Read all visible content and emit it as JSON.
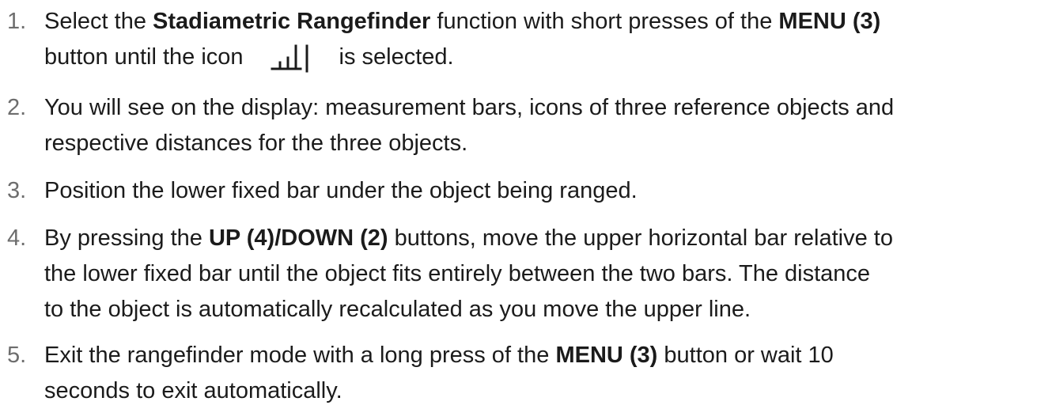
{
  "steps": [
    {
      "number": "1.",
      "line1": {
        "t1": "Select the ",
        "b1": "Stadiametric Rangefinder",
        "t2": " function with short presses of the ",
        "b2": "MENU (3)"
      },
      "line2": {
        "t1": "button until the icon",
        "icon": "stadiametric-rangefinder-icon",
        "t2": "is selected."
      }
    },
    {
      "number": "2.",
      "line1": "You will see on the display: measurement bars, icons of three reference objects and",
      "line2": "respective distances for the three objects."
    },
    {
      "number": "3.",
      "line1": "Position the lower fixed bar under the object being ranged."
    },
    {
      "number": "4.",
      "line1": {
        "t1": "By pressing the ",
        "b1": "UP (4)/DOWN (2)",
        "t2": " buttons, move the upper horizontal bar relative to"
      },
      "line2": "the lower fixed bar until the object fits entirely between the two bars. The distance",
      "line3": "to the object is automatically recalculated as you move the upper line."
    },
    {
      "number": "5.",
      "line1": {
        "t1": "Exit the rangefinder mode with a long press of the ",
        "b1": "MENU (3)",
        "t2": " button or wait 10"
      },
      "line2": "seconds to exit automatically."
    }
  ]
}
